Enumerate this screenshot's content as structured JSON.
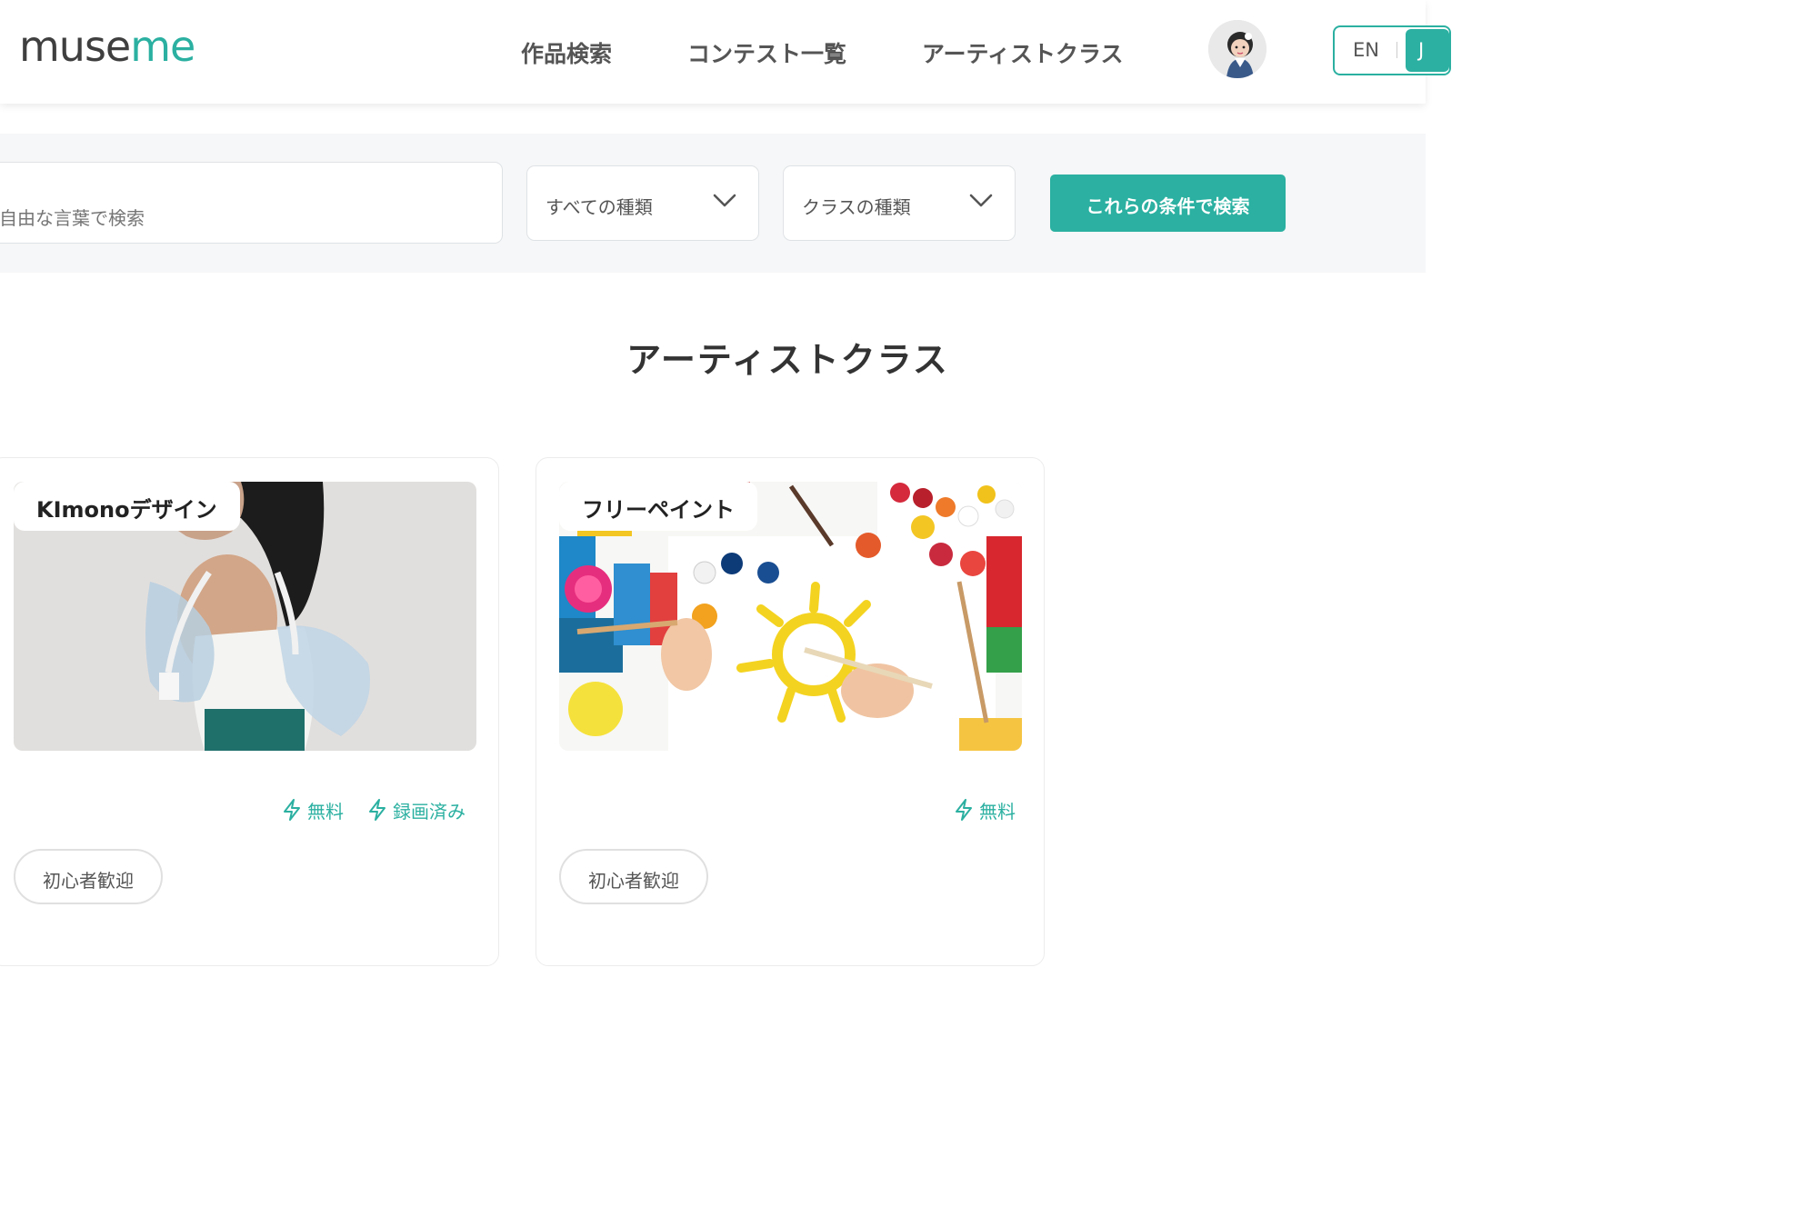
{
  "header": {
    "logo_muse": "muse",
    "logo_me": "me",
    "nav": [
      "作品検索",
      "コンテスト一覧",
      "アーティストクラス"
    ],
    "lang_en": "EN",
    "lang_ja": "J"
  },
  "search": {
    "placeholder": "自由な言葉で検索",
    "type_select": "すべての種類",
    "class_select": "クラスの種類",
    "submit_label": "これらの条件で検索"
  },
  "page_title": "アーティストクラス",
  "cards": [
    {
      "label": "KImonoデザイン",
      "features": [
        "無料",
        "録画済み"
      ],
      "tag": "初心者歓迎"
    },
    {
      "label": "フリーペイント",
      "features": [
        "無料"
      ],
      "tag": "初心者歓迎"
    }
  ],
  "colors": {
    "accent": "#2bb0a1",
    "text": "#333333",
    "band": "#f6f7f8"
  },
  "icons": [
    "chevron-down-icon",
    "lightning-icon",
    "user-avatar"
  ]
}
